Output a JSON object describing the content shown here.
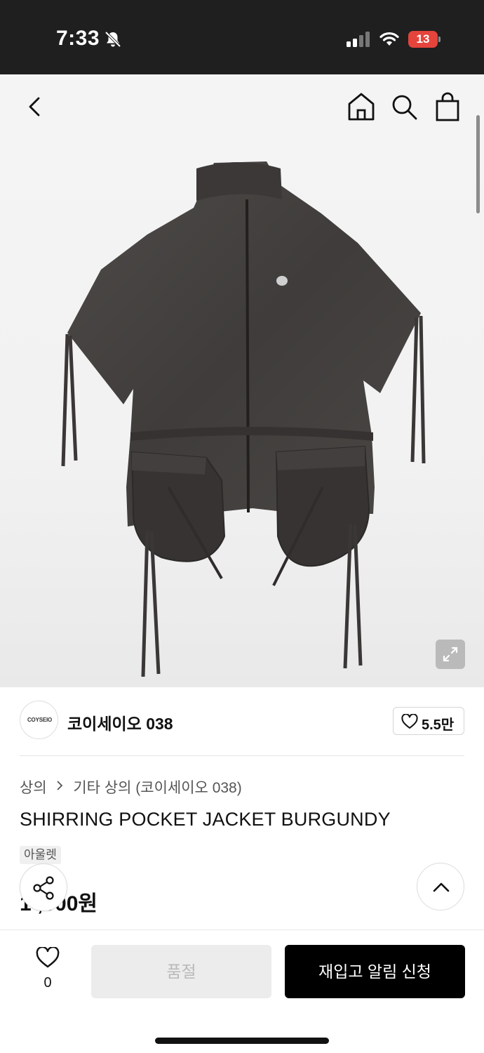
{
  "status_bar": {
    "time": "7:33",
    "battery": "13",
    "icons": [
      "bell-slash-icon",
      "signal-icon",
      "wifi-icon",
      "battery-icon"
    ]
  },
  "nav": {
    "icons": [
      "back-chevron-icon",
      "home-icon",
      "search-icon",
      "shopping-bag-icon"
    ]
  },
  "brand": {
    "logo_text": "COYSEIO",
    "name": "코이세이오 038",
    "likes": "5.5만"
  },
  "breadcrumb": {
    "level1": "상의",
    "level2": "기타 상의 (코이세이오 038)"
  },
  "product": {
    "title": "SHIRRING POCKET JACKET BURGUNDY",
    "tag": "아울렛",
    "price": "1 ,000원"
  },
  "bottom_bar": {
    "wish_count": "0",
    "soldout_label": "품절",
    "restock_label": "재입고 알림 신청"
  },
  "colors": {
    "accent": "#000000",
    "battery_red": "#e4443b",
    "soldout_bg": "#ececec"
  }
}
